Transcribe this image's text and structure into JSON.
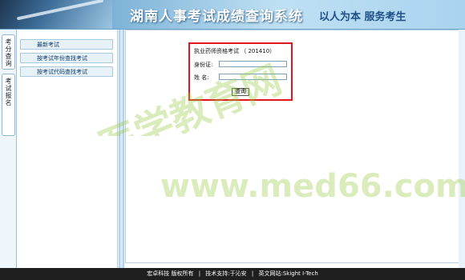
{
  "header": {
    "title": "湖南人事考试成绩查询系统",
    "slogan": "以人为本  服务考生"
  },
  "vertical_tabs": [
    {
      "label": "考分查询"
    },
    {
      "label": "考试报名"
    }
  ],
  "sidebar": {
    "items": [
      {
        "label": "最新考试"
      },
      {
        "label": "按考试年份查找考试"
      },
      {
        "label": "按考试代码查找考试"
      }
    ]
  },
  "query_form": {
    "title": "执业药师资格考试 （ 201410）",
    "id_label": "身份证:",
    "id_value": "",
    "name_label": "姓  名:",
    "name_value": "",
    "submit_label": "查询"
  },
  "footer": {
    "company": "宏卓科技 版权所有",
    "support": "技术支持:于沁安",
    "english_site": "英文网站:Skight I-Tech"
  },
  "watermark": {
    "cn": "医学教育网",
    "en": "www.med66.com"
  },
  "colors": {
    "banner_blue": "#7fb4d8",
    "form_border_red": "#e0161c",
    "footer_bg": "#1f1f1f",
    "watermark_green": "#96c83c"
  }
}
